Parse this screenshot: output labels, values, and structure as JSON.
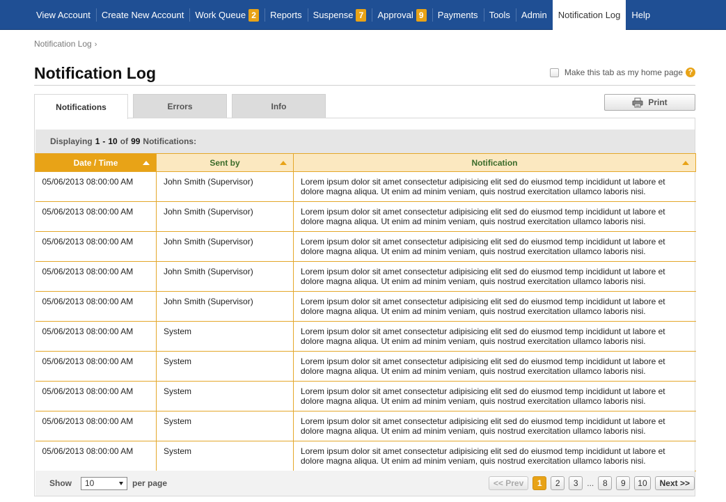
{
  "nav": {
    "items": [
      {
        "label": "View Account",
        "badge": ""
      },
      {
        "label": "Create New Account",
        "badge": ""
      },
      {
        "label": "Work Queue",
        "badge": "2"
      },
      {
        "label": "Reports",
        "badge": ""
      },
      {
        "label": "Suspense",
        "badge": "7"
      },
      {
        "label": "Approval",
        "badge": "9"
      },
      {
        "label": "Payments",
        "badge": ""
      },
      {
        "label": "Tools",
        "badge": ""
      },
      {
        "label": "Admin",
        "badge": ""
      },
      {
        "label": "Notification Log",
        "badge": "",
        "active": true
      },
      {
        "label": "Help",
        "badge": ""
      }
    ]
  },
  "breadcrumb": {
    "label": "Notification Log",
    "separator": "›"
  },
  "page": {
    "title": "Notification Log",
    "home_tab_label": "Make this tab as my home page",
    "help_icon": "?"
  },
  "tabs": [
    {
      "label": "Notifications",
      "active": true
    },
    {
      "label": "Errors",
      "active": false
    },
    {
      "label": "Info",
      "active": false
    }
  ],
  "print": {
    "label": "Print",
    "icon": "printer-icon"
  },
  "summary": {
    "prefix": "Displaying",
    "range_start": "1",
    "dash": "-",
    "range_end": "10",
    "of": "of",
    "total": "99",
    "suffix": "Notifications:"
  },
  "table": {
    "columns": [
      {
        "label": "Date / Time",
        "sorted": true
      },
      {
        "label": "Sent by",
        "sorted": false
      },
      {
        "label": "Notification",
        "sorted": false
      }
    ],
    "rows": [
      {
        "datetime": "05/06/2013 08:00:00 AM",
        "sent_by": "John Smith (Supervisor)",
        "notification": "Lorem ipsum dolor sit amet consectetur adipisicing elit sed do eiusmod temp incididunt ut labore et dolore magna aliqua. Ut enim ad minim veniam, quis nostrud exercitation ullamco laboris nisi."
      },
      {
        "datetime": "05/06/2013 08:00:00 AM",
        "sent_by": "John Smith (Supervisor)",
        "notification": "Lorem ipsum dolor sit amet consectetur adipisicing elit sed do eiusmod temp incididunt ut labore et dolore magna aliqua. Ut enim ad minim veniam, quis nostrud exercitation ullamco laboris nisi."
      },
      {
        "datetime": "05/06/2013 08:00:00 AM",
        "sent_by": "John Smith (Supervisor)",
        "notification": "Lorem ipsum dolor sit amet consectetur adipisicing elit sed do eiusmod temp incididunt ut labore et dolore magna aliqua. Ut enim ad minim veniam, quis nostrud exercitation ullamco laboris nisi."
      },
      {
        "datetime": "05/06/2013 08:00:00 AM",
        "sent_by": "John Smith (Supervisor)",
        "notification": "Lorem ipsum dolor sit amet consectetur adipisicing elit sed do eiusmod temp incididunt ut labore et dolore magna aliqua. Ut enim ad minim veniam, quis nostrud exercitation ullamco laboris nisi."
      },
      {
        "datetime": "05/06/2013 08:00:00 AM",
        "sent_by": "John Smith (Supervisor)",
        "notification": "Lorem ipsum dolor sit amet consectetur adipisicing elit sed do eiusmod temp incididunt ut labore et dolore magna aliqua. Ut enim ad minim veniam, quis nostrud exercitation ullamco laboris nisi."
      },
      {
        "datetime": "05/06/2013 08:00:00 AM",
        "sent_by": "System",
        "notification": "Lorem ipsum dolor sit amet consectetur adipisicing elit sed do eiusmod temp incididunt ut labore et dolore magna aliqua. Ut enim ad minim veniam, quis nostrud exercitation ullamco laboris nisi."
      },
      {
        "datetime": "05/06/2013 08:00:00 AM",
        "sent_by": "System",
        "notification": "Lorem ipsum dolor sit amet consectetur adipisicing elit sed do eiusmod temp incididunt ut labore et dolore magna aliqua. Ut enim ad minim veniam, quis nostrud exercitation ullamco laboris nisi."
      },
      {
        "datetime": "05/06/2013 08:00:00 AM",
        "sent_by": "System",
        "notification": "Lorem ipsum dolor sit amet consectetur adipisicing elit sed do eiusmod temp incididunt ut labore et dolore magna aliqua. Ut enim ad minim veniam, quis nostrud exercitation ullamco laboris nisi."
      },
      {
        "datetime": "05/06/2013 08:00:00 AM",
        "sent_by": "System",
        "notification": "Lorem ipsum dolor sit amet consectetur adipisicing elit sed do eiusmod temp incididunt ut labore et dolore magna aliqua. Ut enim ad minim veniam, quis nostrud exercitation ullamco laboris nisi."
      },
      {
        "datetime": "05/06/2013 08:00:00 AM",
        "sent_by": "System",
        "notification": "Lorem ipsum dolor sit amet consectetur adipisicing elit sed do eiusmod temp incididunt ut labore et dolore magna aliqua. Ut enim ad minim veniam, quis nostrud exercitation ullamco laboris nisi."
      }
    ]
  },
  "footer": {
    "show_label": "Show",
    "per_page_value": "10",
    "per_page_label": "per page",
    "prev_label": "<< Prev",
    "next_label": "Next >>",
    "pages_before": [
      "1",
      "2",
      "3"
    ],
    "ellipsis": "...",
    "pages_after": [
      "8",
      "9",
      "10"
    ],
    "current_page": "1"
  },
  "colors": {
    "nav_bg": "#1f4f94",
    "accent": "#e8a317",
    "header_bg": "#fbe8c0",
    "header_text": "#3b6b2a"
  }
}
